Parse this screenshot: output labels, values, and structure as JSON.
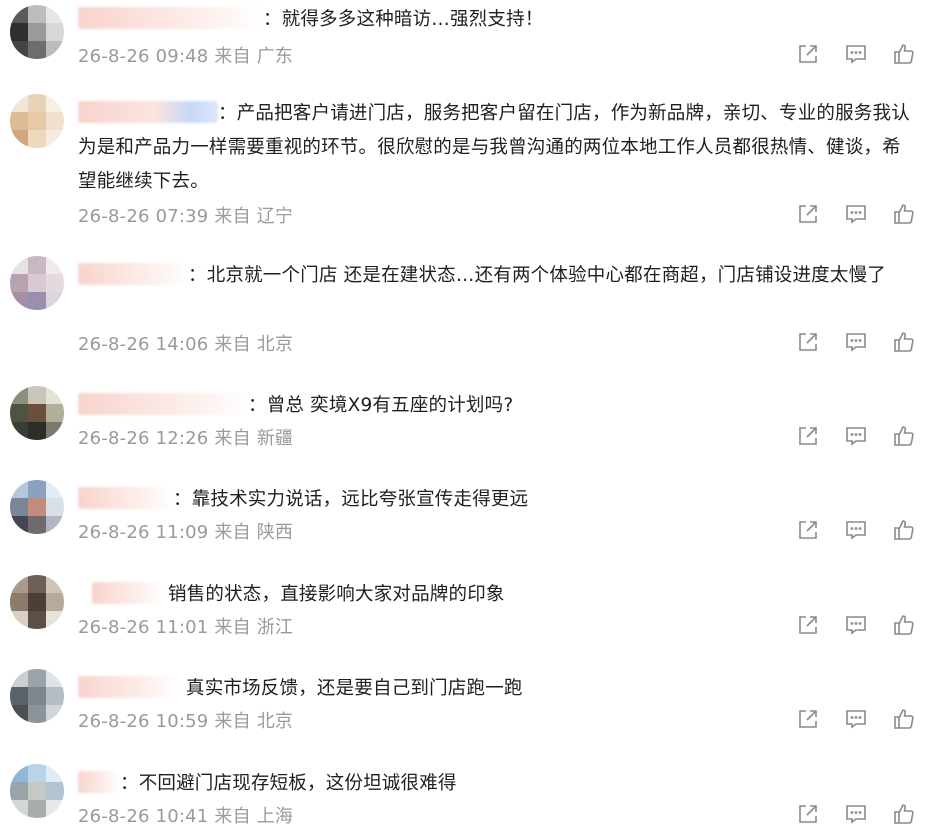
{
  "comments": [
    {
      "text": "：就得多多这种暗访…强烈支持！",
      "time": "26-8-26 09:48",
      "from": "来自",
      "region": "广东"
    },
    {
      "text": "：产品把客户请进门店，服务把客户留在门店，作为新品牌，亲切、专业的服务我认为是和产品力一样需要重视的环节。很欣慰的是与我曾沟通的两位本地工作人员都很热情、健谈，希望能继续下去。",
      "time": "26-8-26 07:39",
      "from": "来自",
      "region": "辽宁"
    },
    {
      "text": "：北京就一个门店 还是在建状态…还有两个体验中心都在商超，门店铺设进度太慢了",
      "time": "26-8-26 14:06",
      "from": "来自",
      "region": "北京"
    },
    {
      "text": "：曾总 奕境X9有五座的计划吗?",
      "time": "26-8-26 12:26",
      "from": "来自",
      "region": "新疆"
    },
    {
      "text": "：靠技术实力说话，远比夸张宣传走得更远",
      "time": "26-8-26 11:09",
      "from": "来自",
      "region": "陕西"
    },
    {
      "text": "销售的状态，直接影响大家对品牌的印象",
      "time": "26-8-26 11:01",
      "from": "来自",
      "region": "浙江"
    },
    {
      "text": "真实市场反馈，还是要自己到门店跑一跑",
      "time": "26-8-26 10:59",
      "from": "来自",
      "region": "北京"
    },
    {
      "text": "：不回避门店现存短板，这份坦诚很难得",
      "time": "26-8-26 10:41",
      "from": "来自",
      "region": "上海"
    }
  ],
  "icons": [
    "share-icon",
    "reply-icon",
    "like-icon"
  ],
  "colors": {
    "text": "#1f1f1f",
    "meta": "#9a9a9a",
    "icon": "#8a8a8a",
    "name_blur": "#f8d3cc"
  }
}
